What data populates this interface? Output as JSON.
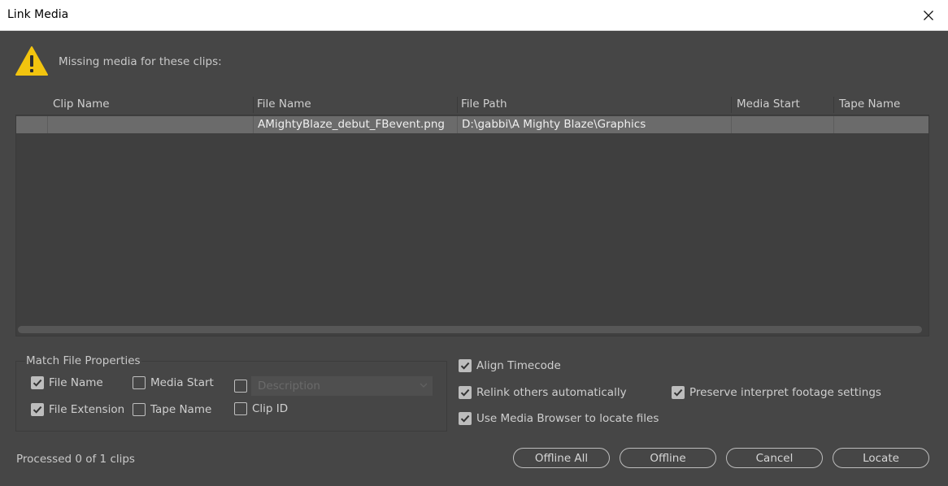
{
  "window": {
    "title": "Link Media"
  },
  "message": "Missing media for these clips:",
  "table": {
    "columns": [
      "Clip Name",
      "File Name",
      "File Path",
      "Media Start",
      "Tape Name"
    ],
    "rows": [
      {
        "clip_name": "",
        "file_name": "AMightyBlaze_debut_FBevent.png",
        "file_path": "D:\\gabbi\\A Mighty Blaze\\Graphics",
        "media_start": "",
        "tape_name": ""
      }
    ]
  },
  "match_group": {
    "label": "Match File Properties",
    "options": {
      "file_name": {
        "label": "File Name",
        "checked": true
      },
      "media_start": {
        "label": "Media Start",
        "checked": false
      },
      "description": {
        "label": "",
        "checked": false,
        "placeholder": "Description"
      },
      "file_extension": {
        "label": "File Extension",
        "checked": true
      },
      "tape_name": {
        "label": "Tape Name",
        "checked": false
      },
      "clip_id": {
        "label": "Clip ID",
        "checked": false
      }
    }
  },
  "options": {
    "align_timecode": {
      "label": "Align Timecode",
      "checked": true
    },
    "relink_others": {
      "label": "Relink others automatically",
      "checked": true
    },
    "use_media_browser": {
      "label": "Use Media Browser to locate files",
      "checked": true
    },
    "preserve_interpret": {
      "label": "Preserve interpret footage settings",
      "checked": true
    }
  },
  "status": "Processed 0 of 1 clips",
  "buttons": {
    "offline_all": "Offline All",
    "offline": "Offline",
    "cancel": "Cancel",
    "locate": "Locate"
  },
  "colors": {
    "background": "#464646",
    "row_selected": "#6b6b6b",
    "warning": "#f2c40f"
  }
}
